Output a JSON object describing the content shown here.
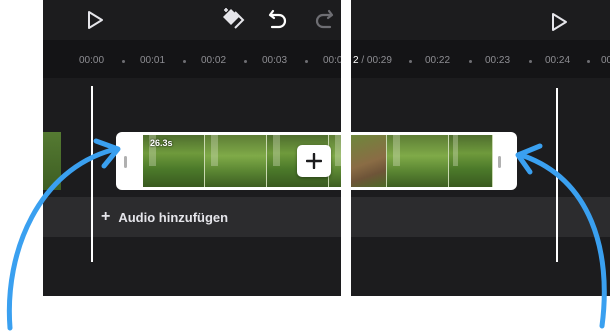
{
  "colors": {
    "panel_bg": "#1c1c1e",
    "ruler_bg": "#141416",
    "audio_track": "#2c2c2e",
    "arrow": "#3aa0f0",
    "clip_border": "#ffffff"
  },
  "icons": {
    "play": "play-icon",
    "keyframe": "keyframe-icon",
    "undo": "undo-icon",
    "redo": "redo-icon",
    "add": "plus-icon"
  },
  "left_panel": {
    "ruler_ticks": [
      "00:00",
      "00:01",
      "00:02",
      "00:03",
      "00:0"
    ],
    "clip": {
      "duration": "26.3s"
    },
    "audio": {
      "plus": "+",
      "label": "Audio hinzufügen"
    }
  },
  "right_panel": {
    "timecode": {
      "current": "2",
      "separator": " / ",
      "total": "00:29"
    },
    "ruler_ticks": [
      "00:22",
      "00:23",
      "00:24",
      "00:"
    ]
  }
}
